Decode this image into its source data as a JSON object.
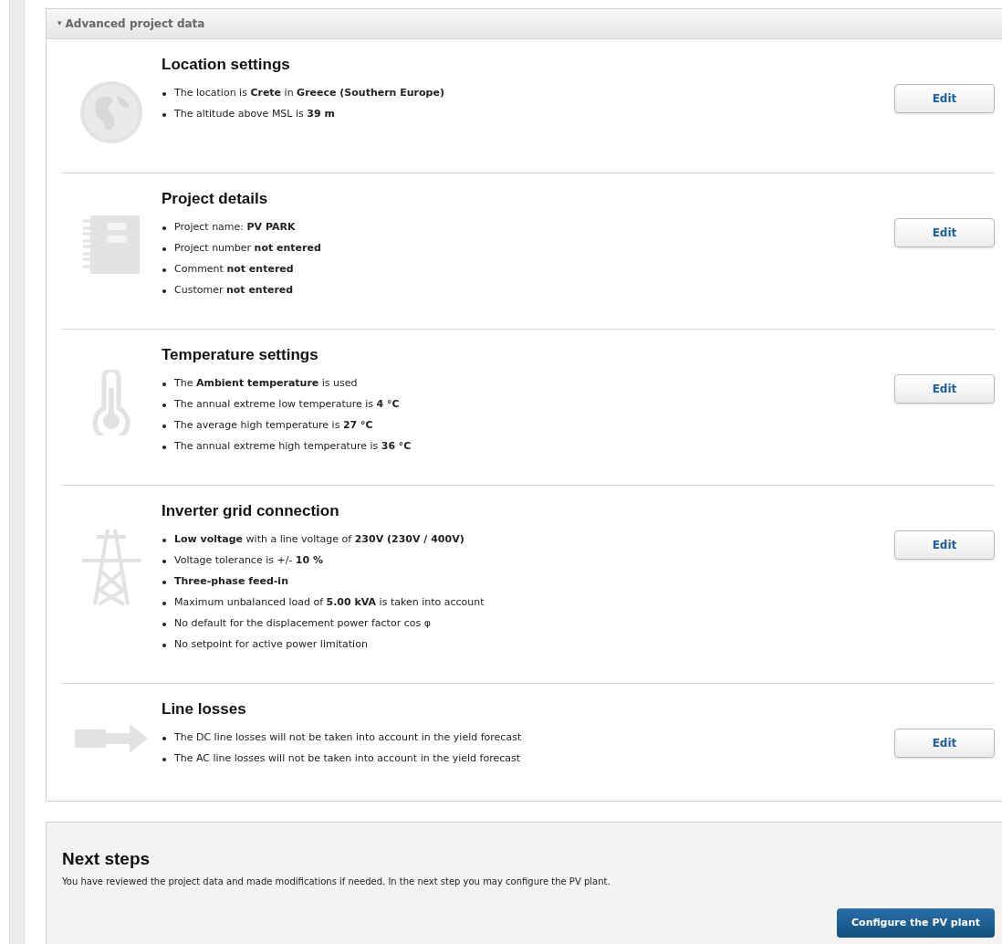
{
  "panel": {
    "toggle": "▾",
    "title": "Advanced project data",
    "expanded": true
  },
  "sections": [
    {
      "kind": "globe",
      "title": "Location settings",
      "items": [
        "The location is **Crete** in **Greece (Southern Europe)**",
        "The altitude above MSL is **39 m**"
      ],
      "button": "Edit"
    },
    {
      "kind": "notebook",
      "title": "Project details",
      "items": [
        "Project name: **PV PARK**",
        "Project number **not entered**",
        "Comment **not entered**",
        "Customer **not entered**"
      ],
      "button": "Edit"
    },
    {
      "kind": "thermometer",
      "title": "Temperature settings",
      "items": [
        "The **Ambient temperature** is used",
        "The annual extreme low temperature is **4 °C**",
        "The average high temperature is **27 °C**",
        "The annual extreme high temperature is **36 °C**"
      ],
      "button": "Edit"
    },
    {
      "kind": "pylon",
      "title": "Inverter grid connection",
      "items": [
        "**Low voltage** with a line voltage of **230V (230V / 400V)**",
        "Voltage tolerance is +/- **10 %**",
        "**Three-phase feed-in**",
        "Maximum unbalanced load of **5.00 kVA** is taken into account",
        "No default for the displacement power factor cos φ",
        "No setpoint for active power limitation"
      ],
      "button": "Edit"
    },
    {
      "kind": "arrow",
      "title": "Line losses",
      "items": [
        "The DC line losses will not be taken into account in the yield forecast",
        "The AC line losses will not be taken into account in the yield forecast"
      ],
      "button": "Edit"
    }
  ],
  "next_steps": {
    "title": "Next steps",
    "text": "You have reviewed the project data and made modifications if needed. In the next step you may configure the PV plant.",
    "button": "Configure the PV plant"
  }
}
